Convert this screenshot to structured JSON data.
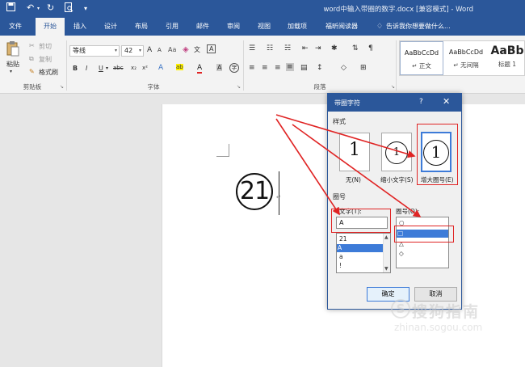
{
  "titlebar": {
    "document_title": "word中输入带圈的数字.docx [兼容模式] - Word",
    "qa_save_icon": "save-icon",
    "qa_undo_icon": "undo-icon",
    "qa_redo_icon": "redo-icon",
    "qa_preview_icon": "print-preview-icon"
  },
  "tabs": [
    {
      "label": "文件"
    },
    {
      "label": "开始"
    },
    {
      "label": "插入"
    },
    {
      "label": "设计"
    },
    {
      "label": "布局"
    },
    {
      "label": "引用"
    },
    {
      "label": "邮件"
    },
    {
      "label": "审阅"
    },
    {
      "label": "视图"
    },
    {
      "label": "加载项"
    },
    {
      "label": "福昕阅读器"
    },
    {
      "label": "告诉我你想要做什么..."
    }
  ],
  "ribbon": {
    "clipboard": {
      "paste_label": "粘贴",
      "cut_label": "剪切",
      "copy_label": "复制",
      "format_painter_label": "格式刷",
      "group_label": "剪贴板"
    },
    "font": {
      "font_name": "等线",
      "font_size": "42",
      "grow": "A",
      "shrink": "A",
      "clear": "Aa",
      "phonetic": "文",
      "border": "A",
      "bold": "B",
      "italic": "I",
      "underline": "U",
      "strike": "abc",
      "subscript": "x₂",
      "superscript": "x²",
      "effects": "A",
      "highlight": "ab",
      "color": "A",
      "shading": "A",
      "enclose": "字",
      "group_label": "字体"
    },
    "paragraph": {
      "group_label": "段落"
    },
    "styles": [
      {
        "sample": "AaBbCcDd",
        "name": "↵ 正文"
      },
      {
        "sample": "AaBbCcDd",
        "name": "↵ 无间隔"
      },
      {
        "sample": "AaBb",
        "name": "标题 1"
      }
    ]
  },
  "document": {
    "enclosed_number": "21",
    "para_mark": "↵"
  },
  "dialog": {
    "title": "带圈字符",
    "help": "?",
    "close": "✕",
    "style_section": "样式",
    "style_options": [
      {
        "glyph": "1",
        "label": "无(N)"
      },
      {
        "glyph": "1",
        "label": "缩小文字(S)"
      },
      {
        "glyph": "1",
        "label": "增大圈号(E)"
      }
    ],
    "ring_section": "圈号",
    "text_label": "文字(T):",
    "text_value": "A",
    "text_list": [
      "21",
      "A",
      "a",
      "!"
    ],
    "text_list_selected": 1,
    "ring_label": "圈号(O):",
    "ring_list": [
      "○",
      "□",
      "△",
      "◇"
    ],
    "ring_list_selected": 1,
    "ok": "确定",
    "cancel": "取消"
  },
  "watermark": {
    "brand": "搜狗指南",
    "url": "zhinan.sogou.com",
    "logo": "S"
  },
  "colors": {
    "accent": "#2b579a",
    "highlight_red": "#e02424",
    "selection_blue": "#3d7bd8"
  }
}
